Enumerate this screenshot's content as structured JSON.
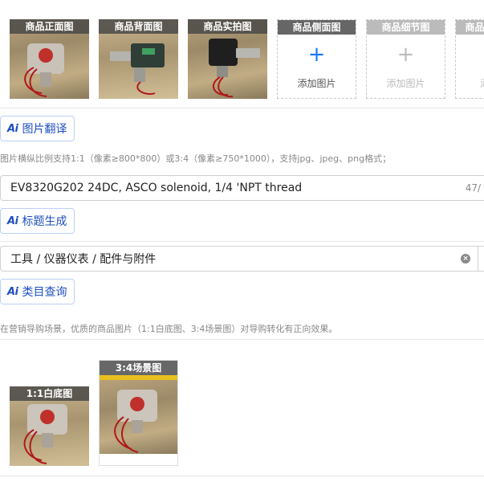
{
  "thumbnails": [
    {
      "label": "商品正面图",
      "type": "photo"
    },
    {
      "label": "商品背面图",
      "type": "photo"
    },
    {
      "label": "商品实拍图",
      "type": "photo"
    },
    {
      "label": "商品侧面图",
      "type": "add",
      "add_text": "添加图片",
      "disabled": false
    },
    {
      "label": "商品细节图",
      "type": "add",
      "add_text": "添加图片",
      "disabled": true
    },
    {
      "label": "商品",
      "type": "add",
      "add_text": "添",
      "disabled": true
    }
  ],
  "image_translate": {
    "ai_icon": "Ai",
    "label": "图片翻译"
  },
  "image_hint": "图片横纵比例支持1:1（像素≥800*800）或3:4（像素≥750*1000），支持jpg、jpeg、png格式；",
  "title_field": {
    "value": "EV8320G202 24DC, ASCO solenoid, 1/4 'NPT thread",
    "count": "47/"
  },
  "title_generate": {
    "ai_icon": "Ai",
    "label": "标题生成"
  },
  "category_field": {
    "value": "工具 / 仪器仪表 / 配件与附件"
  },
  "category_query": {
    "ai_icon": "Ai",
    "label": "类目查询"
  },
  "marketing_hint": "在营销导购场景，优质的商品图片（1:1白底图、3:4场景图）对导购转化有正向效果。",
  "scene_images": [
    {
      "label": "1:1白底图"
    },
    {
      "label": "3:4场景图"
    }
  ],
  "colors": {
    "accent": "#1677ff",
    "ai_blue": "#1f4fbf",
    "label_bg": "#666666"
  }
}
